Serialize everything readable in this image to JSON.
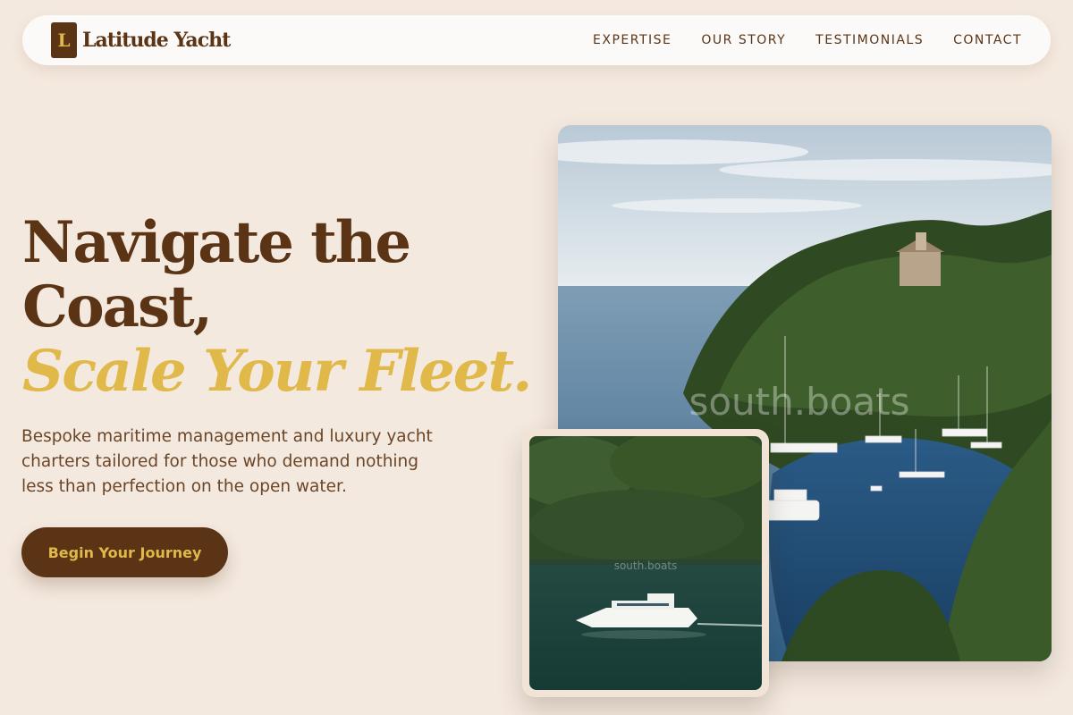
{
  "brand": {
    "logo_letter": "L",
    "name": "Latitude Yacht"
  },
  "nav": {
    "items": [
      {
        "label": "EXPERTISE"
      },
      {
        "label": "OUR STORY"
      },
      {
        "label": "TESTIMONIALS"
      },
      {
        "label": "CONTACT"
      }
    ]
  },
  "hero": {
    "title_line1": "Navigate the",
    "title_line2": "Coast,",
    "title_accent": "Scale Your Fleet.",
    "description": "Bespoke maritime management and luxury yacht charters tailored for those who demand nothing less than perfection on the open water.",
    "cta_label": "Begin Your Journey"
  },
  "images": {
    "main_watermark": "south.boats",
    "small_watermark": "south.boats"
  },
  "colors": {
    "background": "#f4e9df",
    "brown": "#5b3416",
    "gold": "#e0b94a"
  }
}
